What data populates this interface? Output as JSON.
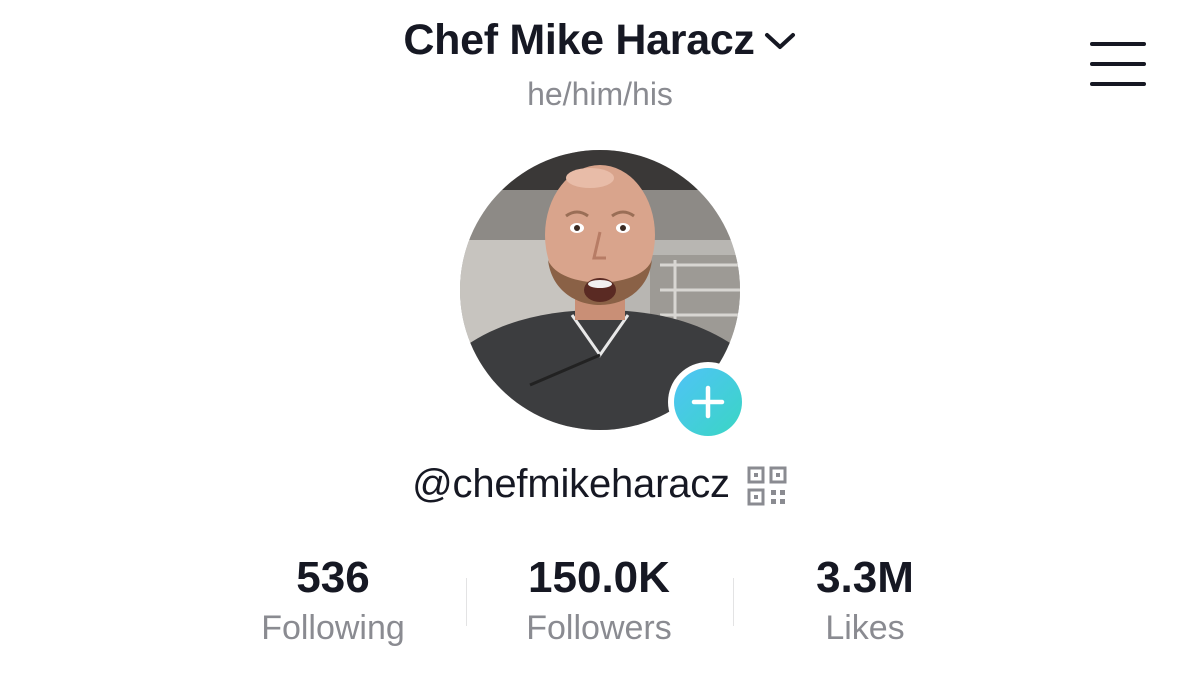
{
  "profile": {
    "display_name": "Chef Mike Haracz",
    "pronouns": "he/him/his",
    "username": "@chefmikeharacz"
  },
  "stats": [
    {
      "value": "536",
      "label": "Following"
    },
    {
      "value": "150.0K",
      "label": "Followers"
    },
    {
      "value": "3.3M",
      "label": "Likes"
    }
  ],
  "icons": {
    "chevron": "chevron-down-icon",
    "menu": "hamburger-menu-icon",
    "add": "plus-icon",
    "qr": "qr-code-icon"
  },
  "colors": {
    "text_primary": "#161823",
    "text_secondary": "#8a8b91",
    "add_button_start": "#4fc3f7",
    "add_button_end": "#3ad6c4"
  }
}
